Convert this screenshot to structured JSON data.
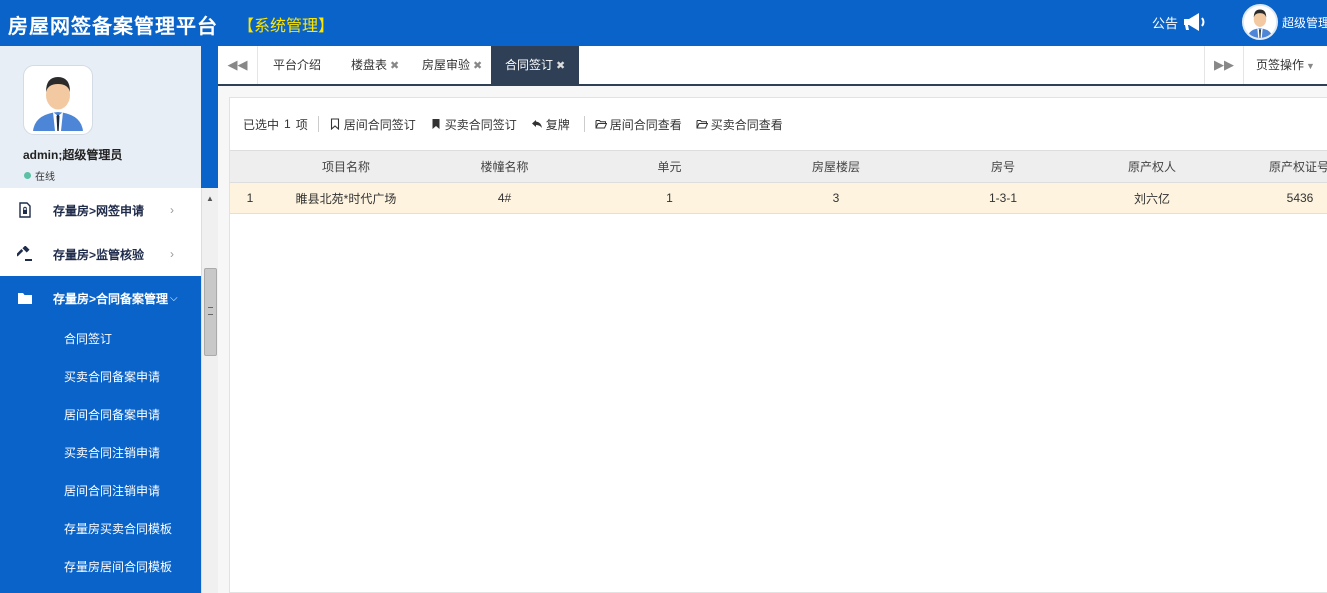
{
  "header": {
    "app_title": "房屋网签备案管理平台",
    "module_tag": "【系统管理】",
    "notice_label": "公告",
    "user_name": "超级管理"
  },
  "sidebar": {
    "profile_name": "admin;超级管理员",
    "profile_status": "在线",
    "menu": [
      {
        "label": "存量房>网签申请",
        "icon": "file-lock-icon"
      },
      {
        "label": "存量房>监管核验",
        "icon": "gavel-icon"
      },
      {
        "label": "存量房>合同备案管理",
        "icon": "folder-icon"
      }
    ],
    "submenu": [
      "合同签订",
      "买卖合同备案申请",
      "居间合同备案申请",
      "买卖合同注销申请",
      "居间合同注销申请",
      "存量房买卖合同模板",
      "存量房居间合同模板"
    ]
  },
  "tabs": {
    "items": [
      "平台介绍",
      "楼盘表",
      "房屋审验",
      "合同签订"
    ],
    "active": "合同签订",
    "close_glyph": "✖",
    "ops_label": "页签操作"
  },
  "toolbar": {
    "selected_prefix": "已选中",
    "selected_count": "1",
    "selected_suffix": "项",
    "buttons": [
      "居间合同签订",
      "买卖合同签订",
      "复牌",
      "居间合同查看",
      "买卖合同查看"
    ]
  },
  "grid": {
    "columns": [
      "项目名称",
      "楼幢名称",
      "单元",
      "房屋楼层",
      "房号",
      "原产权人",
      "原产权证号"
    ],
    "rows": [
      {
        "index": "1",
        "project": "睢县北苑*时代广场",
        "building": "4#",
        "unit": "1",
        "floor": "3",
        "room": "1-3-1",
        "owner": "刘六亿",
        "cert": "5436"
      }
    ]
  },
  "colors": {
    "primary": "#0a63c8",
    "module_tag": "#ffe600",
    "tab_active": "#2f3f55",
    "row_selected": "#fdf3df"
  }
}
